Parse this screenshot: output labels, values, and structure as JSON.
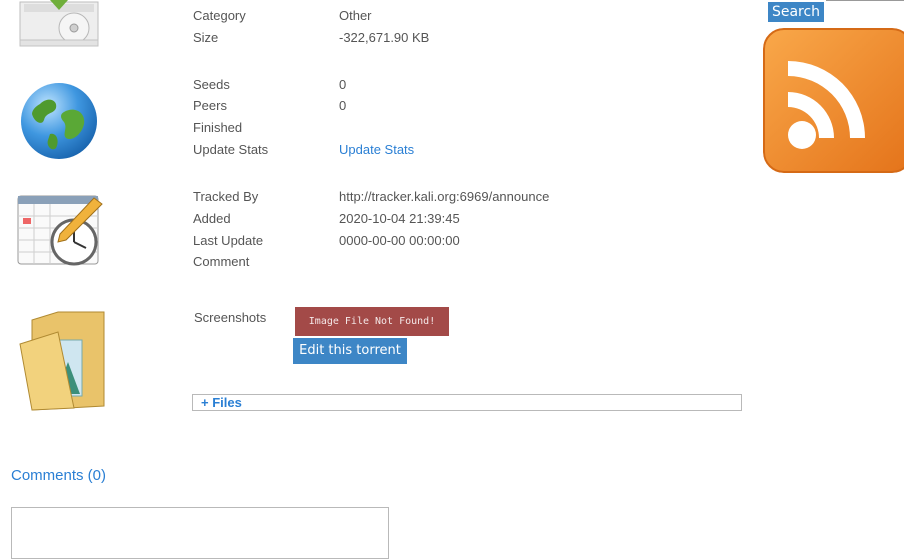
{
  "search": {
    "button_label": "Search"
  },
  "general": {
    "category_label": "Category",
    "category_value": "Other",
    "size_label": "Size",
    "size_value": "-322,671.90 KB"
  },
  "stats": {
    "seeds_label": "Seeds",
    "seeds_value": "0",
    "peers_label": "Peers",
    "peers_value": "0",
    "finished_label": "Finished",
    "update_stats_label": "Update Stats",
    "update_stats_link": "Update Stats"
  },
  "tracker": {
    "tracked_by_label": "Tracked By",
    "tracked_by_value": "http://tracker.kali.org:6969/announce",
    "added_label": "Added",
    "added_value": "2020-10-04 21:39:45",
    "last_update_label": "Last Update",
    "last_update_value": "0000-00-00 00:00:00",
    "comment_label": "Comment"
  },
  "media": {
    "screenshots_label": "Screenshots",
    "image_not_found": "Image File Not Found!",
    "edit_button": "Edit this torrent",
    "files_toggle": "+ Files"
  },
  "comments": {
    "title": "Comments (0)"
  },
  "icons": [
    "package-disc-icon",
    "globe-icon",
    "calendar-clock-icon",
    "folder-icon",
    "rss-feed-icon"
  ],
  "colors": {
    "accent": "#3d86c6",
    "link": "#2a7fd4",
    "error_badge": "#a34a48",
    "rss": "#f08a24"
  }
}
